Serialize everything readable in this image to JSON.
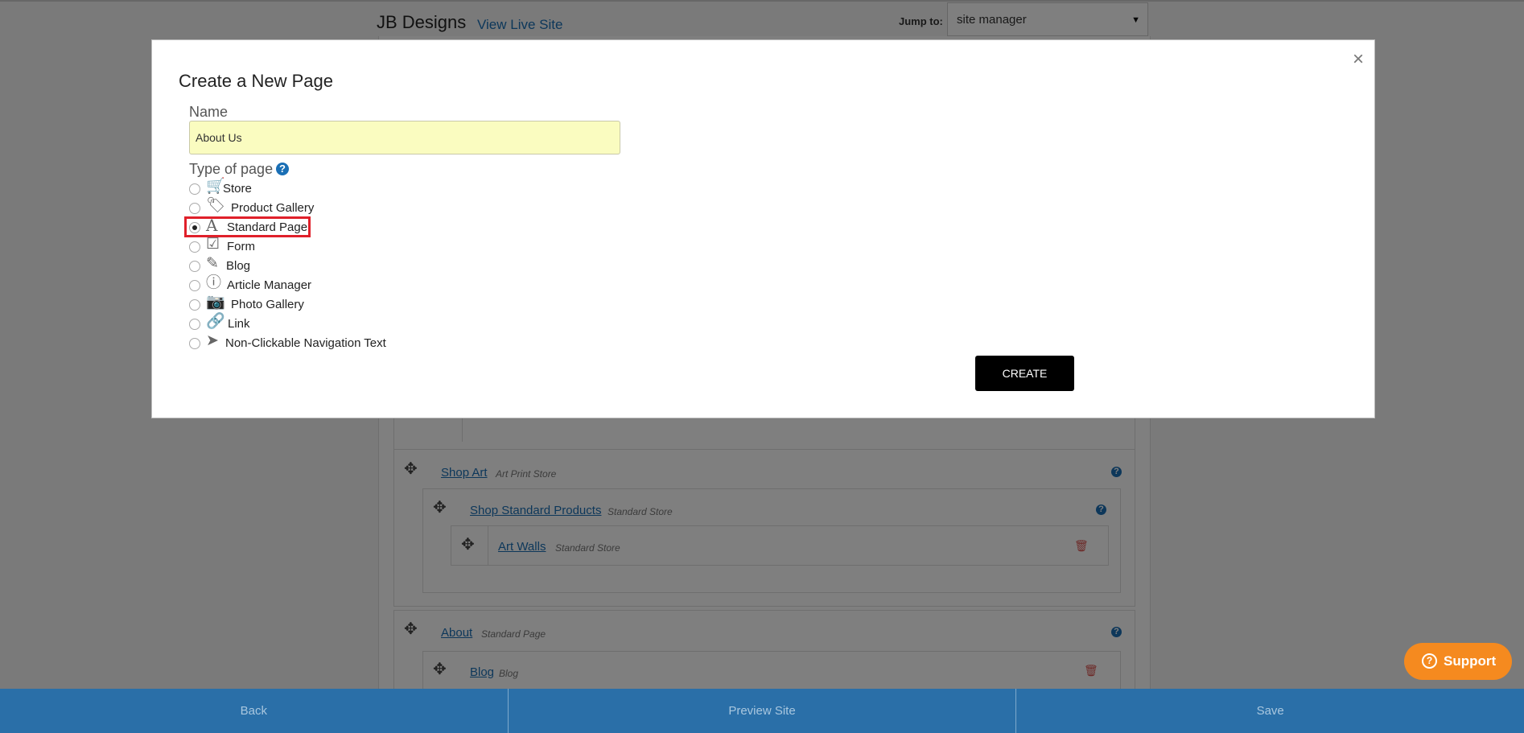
{
  "header": {
    "site_title": "JB Designs",
    "view_live_label": "View Live Site",
    "jump_label": "Jump to:",
    "jump_value": "site manager"
  },
  "tree": {
    "shop_art": {
      "label": "Shop Art",
      "type": "Art Print Store"
    },
    "shop_standard": {
      "label": "Shop Standard Products",
      "type": "Standard Store"
    },
    "art_walls": {
      "label": "Art Walls",
      "type": "Standard Store"
    },
    "about": {
      "label": "About",
      "type": "Standard Page"
    },
    "blog": {
      "label": "Blog",
      "type": "Blog"
    }
  },
  "modal": {
    "title": "Create a New Page",
    "close_symbol": "×",
    "name_label": "Name",
    "name_value": "About Us",
    "type_label": "Type of page",
    "selected_type": "Standard Page",
    "options": [
      {
        "label": "Store",
        "icon": "cart-icon",
        "checked": false
      },
      {
        "label": "Product Gallery",
        "icon": "tags-icon",
        "checked": false
      },
      {
        "label": "Standard Page",
        "icon": "font-icon",
        "checked": true
      },
      {
        "label": "Form",
        "icon": "checkbox-icon",
        "checked": false
      },
      {
        "label": "Blog",
        "icon": "pencil-icon",
        "checked": false
      },
      {
        "label": "Article Manager",
        "icon": "info-icon",
        "checked": false
      },
      {
        "label": "Photo Gallery",
        "icon": "camera-icon",
        "checked": false
      },
      {
        "label": "Link",
        "icon": "link-icon",
        "checked": false
      },
      {
        "label": "Non-Clickable Navigation Text",
        "icon": "location-arrow-icon",
        "checked": false
      }
    ],
    "create_label": "CREATE"
  },
  "footer": {
    "back_label": "Back",
    "preview_label": "Preview Site",
    "save_label": "Save"
  },
  "support": {
    "label": "Support"
  },
  "colors": {
    "accent": "#1a6fb5",
    "bottom_bar": "#2a6fa8",
    "support": "#f58a1f",
    "name_input_bg": "#fafcc0",
    "highlight": "#e0202a"
  }
}
